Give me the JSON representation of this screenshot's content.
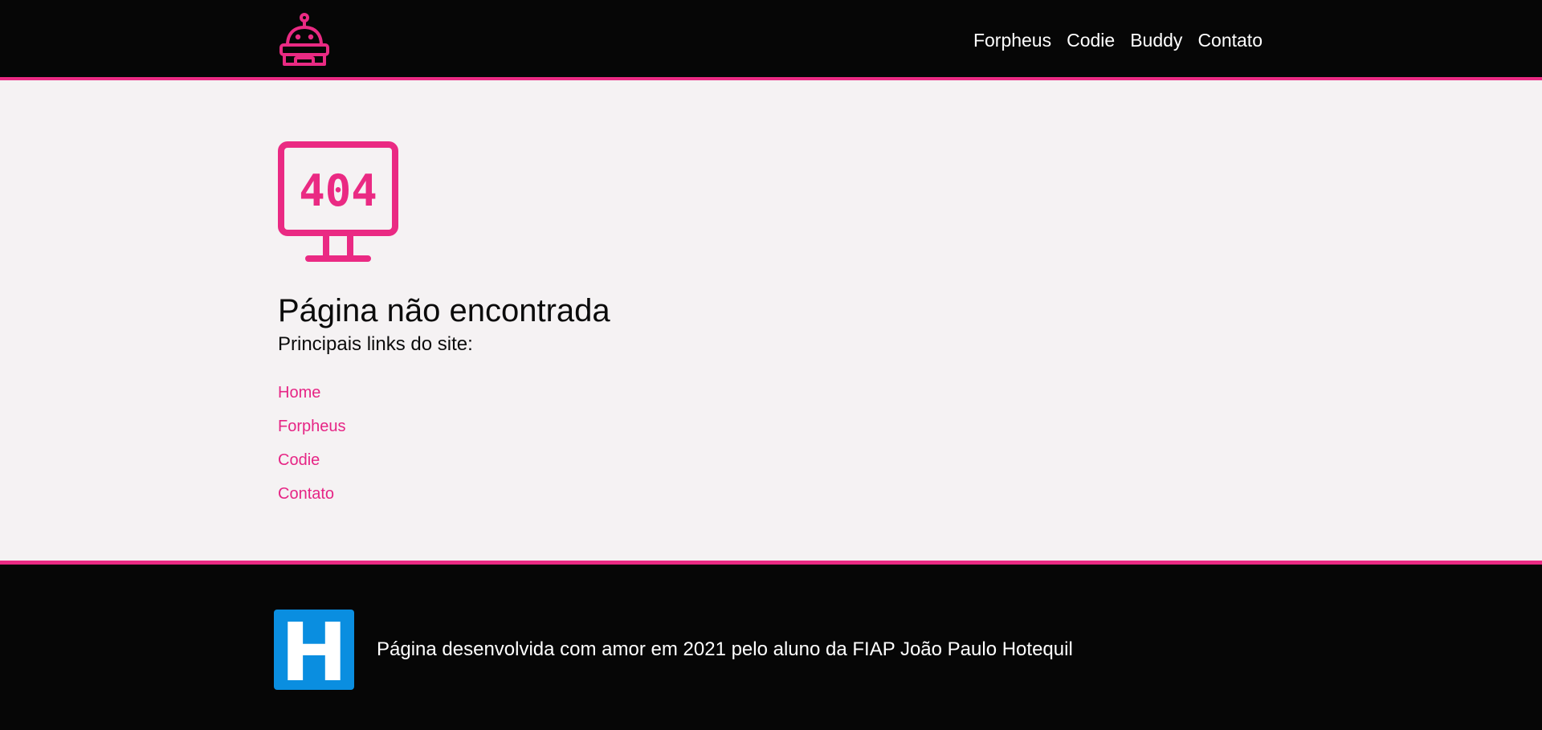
{
  "colors": {
    "accent": "#ea2a83",
    "header_bg": "#060606",
    "page_bg": "#f5f2f3",
    "footer_logo_bg": "#0a8ee0"
  },
  "header": {
    "logo_icon": "robot-icon",
    "nav": [
      {
        "label": "Forpheus"
      },
      {
        "label": "Codie"
      },
      {
        "label": "Buddy"
      },
      {
        "label": "Contato"
      }
    ]
  },
  "main": {
    "icon": "404-monitor-icon",
    "icon_text": "404",
    "title": "Página não encontrada",
    "subtitle": "Principais links do site:",
    "links": [
      {
        "label": "Home"
      },
      {
        "label": "Forpheus"
      },
      {
        "label": "Codie"
      },
      {
        "label": "Contato"
      }
    ]
  },
  "footer": {
    "logo_icon": "h-logo-icon",
    "logo_letter": "H",
    "text": "Página desenvolvida com amor em 2021 pelo aluno da FIAP João Paulo Hotequil"
  }
}
